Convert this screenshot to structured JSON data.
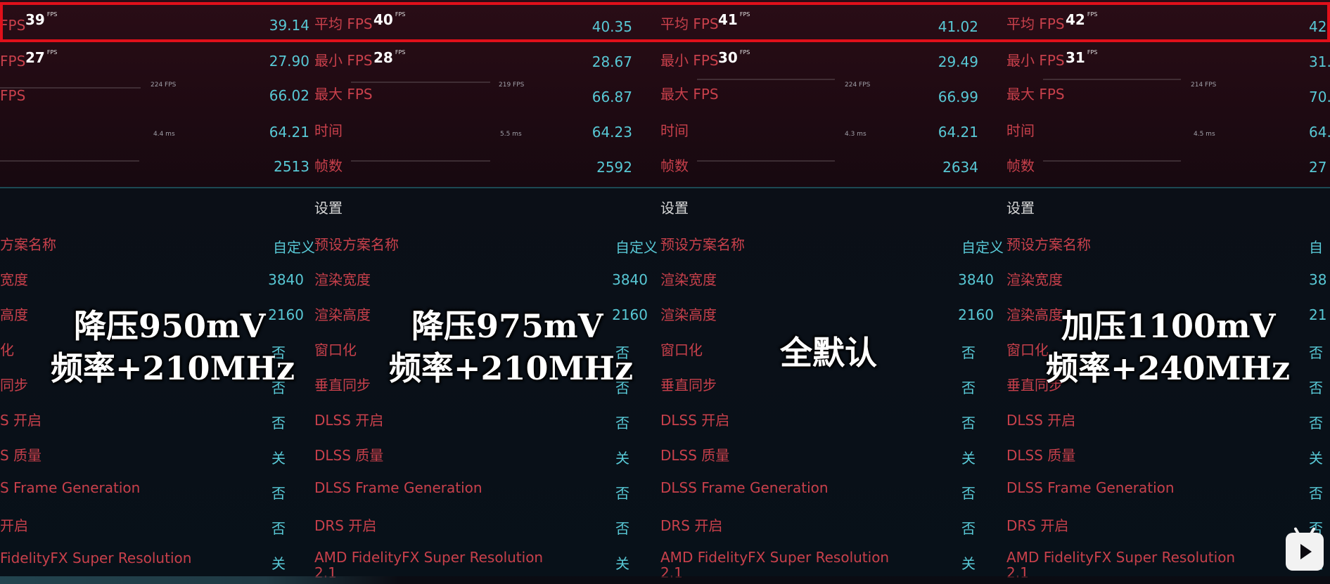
{
  "panels": [
    {
      "graph": {
        "avg_num": "39",
        "min_num": "27",
        "unit": "FPS",
        "max_tick": "224 FPS",
        "time_tick": "4.4 ms"
      },
      "stats": [
        {
          "label": "FPS",
          "value": "39.14"
        },
        {
          "label": "FPS",
          "value": "27.90"
        },
        {
          "label": "FPS",
          "value": "66.02"
        },
        {
          "label": "",
          "value": "64.21"
        },
        {
          "label": "",
          "value": "2513"
        }
      ],
      "settings_header": "",
      "settings": [
        {
          "label": "方案名称",
          "value": "自定义"
        },
        {
          "label": "宽度",
          "value": "3840"
        },
        {
          "label": "高度",
          "value": "2160"
        },
        {
          "label": "化",
          "value": "否"
        },
        {
          "label": "同步",
          "value": "否"
        },
        {
          "label": "S 开启",
          "value": "否"
        },
        {
          "label": "S 质量",
          "value": "关"
        },
        {
          "label": "S Frame Generation",
          "value": "否"
        },
        {
          "label": "开启",
          "value": "否"
        },
        {
          "label": " FidelityFX Super Resolution",
          "value": "关"
        }
      ],
      "caption": [
        "降压950mV",
        "频率+210MHz"
      ]
    },
    {
      "graph": {
        "avg_num": "40",
        "min_num": "28",
        "unit": "FPS",
        "max_tick": "219 FPS",
        "time_tick": "5.5 ms"
      },
      "stats": [
        {
          "label": "平均 FPS",
          "value": "40.35"
        },
        {
          "label": "最小 FPS",
          "value": "28.67"
        },
        {
          "label": "最大 FPS",
          "value": "66.87"
        },
        {
          "label": "时间",
          "value": "64.23"
        },
        {
          "label": "帧数",
          "value": "2592"
        }
      ],
      "settings_header": "设置",
      "settings": [
        {
          "label": "预设方案名称",
          "value": "自定义"
        },
        {
          "label": "渲染宽度",
          "value": "3840"
        },
        {
          "label": "渲染高度",
          "value": "2160"
        },
        {
          "label": "窗口化",
          "value": "否"
        },
        {
          "label": "垂直同步",
          "value": "否"
        },
        {
          "label": "DLSS 开启",
          "value": "否"
        },
        {
          "label": "DLSS 质量",
          "value": "关"
        },
        {
          "label": "DLSS Frame Generation",
          "value": "否"
        },
        {
          "label": "DRS 开启",
          "value": "否"
        },
        {
          "label": "AMD FidelityFX Super Resolution 2.1",
          "value": "关"
        }
      ],
      "caption": [
        "降压975mV",
        "频率+210MHz"
      ]
    },
    {
      "graph": {
        "avg_num": "41",
        "min_num": "30",
        "unit": "FPS",
        "max_tick": "224 FPS",
        "time_tick": "4.3 ms"
      },
      "stats": [
        {
          "label": "平均 FPS",
          "value": "41.02"
        },
        {
          "label": "最小 FPS",
          "value": "29.49"
        },
        {
          "label": "最大 FPS",
          "value": "66.99"
        },
        {
          "label": "时间",
          "value": "64.21"
        },
        {
          "label": "帧数",
          "value": "2634"
        }
      ],
      "settings_header": "设置",
      "settings": [
        {
          "label": "预设方案名称",
          "value": "自定义"
        },
        {
          "label": "渲染宽度",
          "value": "3840"
        },
        {
          "label": "渲染高度",
          "value": "2160"
        },
        {
          "label": "窗口化",
          "value": "否"
        },
        {
          "label": "垂直同步",
          "value": "否"
        },
        {
          "label": "DLSS 开启",
          "value": "否"
        },
        {
          "label": "DLSS 质量",
          "value": "关"
        },
        {
          "label": "DLSS Frame Generation",
          "value": "否"
        },
        {
          "label": "DRS 开启",
          "value": "否"
        },
        {
          "label": "AMD FidelityFX Super Resolution 2.1",
          "value": "关"
        }
      ],
      "caption": [
        "全默认"
      ]
    },
    {
      "graph": {
        "avg_num": "42",
        "min_num": "31",
        "unit": "FPS",
        "max_tick": "214 FPS",
        "time_tick": "4.5 ms"
      },
      "stats": [
        {
          "label": "平均 FPS",
          "value": "42."
        },
        {
          "label": "最小 FPS",
          "value": "31."
        },
        {
          "label": "最大 FPS",
          "value": "70."
        },
        {
          "label": "时间",
          "value": "64."
        },
        {
          "label": "帧数",
          "value": "27"
        }
      ],
      "settings_header": "设置",
      "settings": [
        {
          "label": "预设方案名称",
          "value": "自"
        },
        {
          "label": "渲染宽度",
          "value": "38"
        },
        {
          "label": "渲染高度",
          "value": "21"
        },
        {
          "label": "窗口化",
          "value": "否"
        },
        {
          "label": "垂直同步",
          "value": "否"
        },
        {
          "label": "DLSS 开启",
          "value": "否"
        },
        {
          "label": "DLSS 质量",
          "value": "关"
        },
        {
          "label": "DLSS Frame Generation",
          "value": "否"
        },
        {
          "label": "DRS 开启",
          "value": "否"
        },
        {
          "label": "AMD FidelityFX Super Resolution 2.1",
          "value": "关"
        }
      ],
      "caption": [
        "加压1100mV",
        "频率+240MHz"
      ]
    }
  ],
  "highlight_color": "#e0101a",
  "label_color": "#c8404b",
  "value_color": "#58c8d5"
}
